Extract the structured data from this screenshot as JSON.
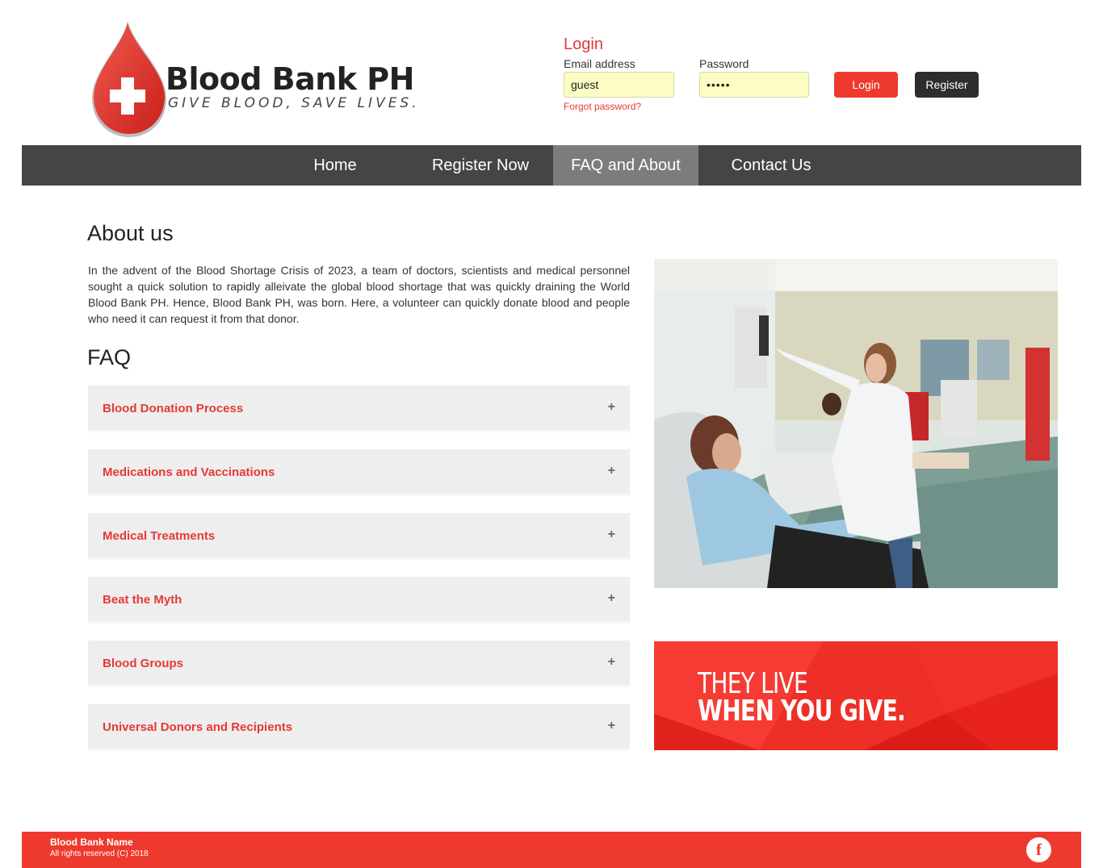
{
  "brand": {
    "name": "Blood Bank PH",
    "tagline": "GIVE BLOOD, SAVE LIVES.",
    "accent_color": "#ee3a2e",
    "dark_color": "#454545"
  },
  "login": {
    "title": "Login",
    "email_label": "Email address",
    "email_value": "guest",
    "password_label": "Password",
    "password_value": "•••••",
    "forgot_label": "Forgot password?",
    "login_button": "Login",
    "register_button": "Register"
  },
  "nav": {
    "items": [
      {
        "label": "Home",
        "active": false
      },
      {
        "label": "Register Now",
        "active": false
      },
      {
        "label": "FAQ and About",
        "active": true
      },
      {
        "label": "Contact Us",
        "active": false
      }
    ]
  },
  "about": {
    "heading": "About us",
    "text": "In the advent of the Blood Shortage Crisis of 2023, a team of doctors, scientists and medical personnel sought a quick solution to rapidly alleivate the global blood shortage that was quickly draining the World Blood Bank PH. Hence, Blood Bank PH, was born. Here, a volunteer can quickly donate blood and people who need it can request it from that donor."
  },
  "faq": {
    "heading": "FAQ",
    "expand_symbol": "+",
    "items": [
      {
        "label": "Blood Donation Process"
      },
      {
        "label": "Medications and Vaccinations"
      },
      {
        "label": "Medical Treatments"
      },
      {
        "label": "Beat the Myth"
      },
      {
        "label": "Blood Groups"
      },
      {
        "label": "Universal Donors and Recipients"
      }
    ]
  },
  "banner": {
    "line1": "THEY LIVE",
    "line2": "WHEN YOU GIVE."
  },
  "footer": {
    "name": "Blood Bank Name",
    "copyright": "All rights reserved (C) 2018",
    "social_icon": "facebook-icon",
    "social_glyph": "f"
  }
}
